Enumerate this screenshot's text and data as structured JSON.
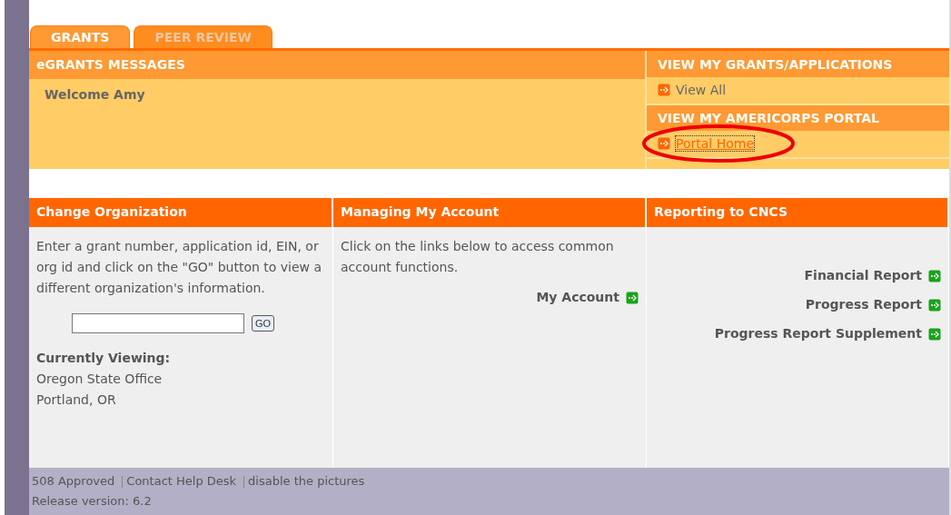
{
  "tabs": [
    {
      "label": "GRANTS",
      "selected": true
    },
    {
      "label": "PEER REVIEW",
      "selected": false
    }
  ],
  "messages": {
    "title": "eGRANTS MESSAGES",
    "text": "Welcome Amy"
  },
  "side_panels": [
    {
      "title": "VIEW MY GRANTS/APPLICATIONS",
      "link": "View All",
      "highlighted": false
    },
    {
      "title": "VIEW MY AMERICORPS PORTAL",
      "link": "Portal Home",
      "highlighted": true
    }
  ],
  "columns": [
    {
      "kind": "org",
      "title": "Change Organization",
      "text": "Enter a grant number, application id, EIN, or org id and click on the \"GO\" button to view a different organization's information.",
      "button": "GO",
      "viewing_label": "Currently Viewing:",
      "viewing_lines": [
        "Oregon State Office",
        "Portland, OR"
      ]
    },
    {
      "kind": "links",
      "title": "Managing My Account",
      "text": "Click on the links below to access common account functions.",
      "links": [
        "My Account"
      ]
    },
    {
      "kind": "links",
      "title": "Reporting to CNCS",
      "links": [
        "Financial Report",
        "Progress Report",
        "Progress Report Supplement"
      ]
    }
  ],
  "footer": {
    "links": [
      "508 Approved",
      "Contact Help Desk",
      "disable the pictures"
    ],
    "release": "Release version: 6.2"
  }
}
